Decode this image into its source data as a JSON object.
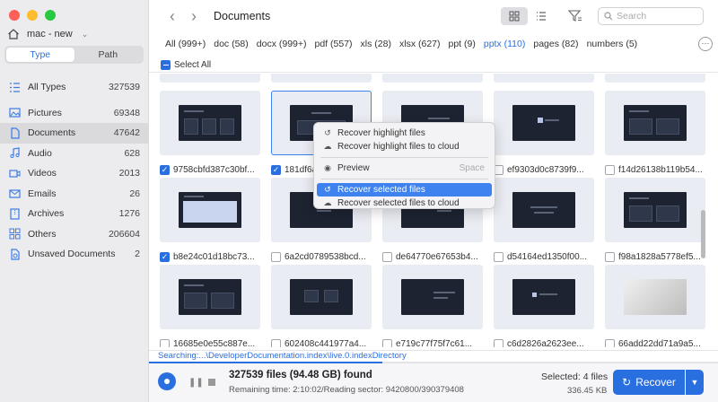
{
  "sidebar": {
    "device_name": "mac - new",
    "segments": [
      "Type",
      "Path"
    ],
    "items": [
      {
        "label": "All Types",
        "count": "327539",
        "icon": "list-icon"
      },
      {
        "label": "Pictures",
        "count": "69348",
        "icon": "picture-icon"
      },
      {
        "label": "Documents",
        "count": "47642",
        "icon": "document-icon"
      },
      {
        "label": "Audio",
        "count": "628",
        "icon": "audio-icon"
      },
      {
        "label": "Videos",
        "count": "2013",
        "icon": "video-icon"
      },
      {
        "label": "Emails",
        "count": "26",
        "icon": "email-icon"
      },
      {
        "label": "Archives",
        "count": "1276",
        "icon": "archive-icon"
      },
      {
        "label": "Others",
        "count": "206604",
        "icon": "others-icon"
      },
      {
        "label": "Unsaved Documents",
        "count": "2",
        "icon": "unsaved-icon"
      }
    ]
  },
  "header": {
    "title": "Documents",
    "search_placeholder": "Search"
  },
  "tabs": [
    "All (999+)",
    "doc (58)",
    "docx (999+)",
    "pdf (557)",
    "xls (28)",
    "xlsx (627)",
    "ppt (9)",
    "pptx (110)",
    "pages (82)",
    "numbers (5)"
  ],
  "select_all": "Select All",
  "grid": {
    "rows": [
      [
        {
          "name": "9758cbfd387c30bf...",
          "checked": true
        },
        {
          "name": "181df6a",
          "checked": true,
          "highlight": true
        },
        {
          "name": "",
          "checked": false
        },
        {
          "name": "ef9303d0c8739f9...",
          "checked": false
        },
        {
          "name": "f14d26138b119b54...",
          "checked": false
        }
      ],
      [
        {
          "name": "b8e24c01d18bc73...",
          "checked": true
        },
        {
          "name": "6a2cd0789538bcd...",
          "checked": false
        },
        {
          "name": "de64770e67653b4...",
          "checked": false
        },
        {
          "name": "d54164ed1350f00...",
          "checked": false
        },
        {
          "name": "f98a1828a5778ef5...",
          "checked": false
        }
      ],
      [
        {
          "name": "16685e0e55c887e...",
          "checked": false
        },
        {
          "name": "602408c441977a4...",
          "checked": false
        },
        {
          "name": "e719c77f75f7c61...",
          "checked": false
        },
        {
          "name": "c6d2826a2623ee...",
          "checked": false
        },
        {
          "name": "66add22dd71a9a5...",
          "checked": false
        }
      ]
    ]
  },
  "context_menu": {
    "items": [
      {
        "label": "Recover highlight files",
        "icon": "recover-icon"
      },
      {
        "label": "Recover highlight files to cloud",
        "icon": "cloud-icon"
      },
      {
        "label": "Preview",
        "icon": "eye-icon",
        "shortcut": "Space"
      },
      {
        "label": "Recover selected files",
        "icon": "recover-icon",
        "active": true
      },
      {
        "label": "Recover selected files to cloud",
        "icon": "cloud-icon"
      }
    ]
  },
  "status": {
    "searching": "Searching:...\\DeveloperDocumentation.index\\live.0.indexDirectory",
    "progress": 0.41,
    "found": "327539 files (94.48 GB) found",
    "remaining": "Remaining time: 2:10:02/Reading sector: 9420800/390379408",
    "selected": "Selected: 4 files",
    "selected_size": "336.45 KB",
    "recover_label": "Recover"
  },
  "colors": {
    "accent": "#2a6fe0"
  }
}
